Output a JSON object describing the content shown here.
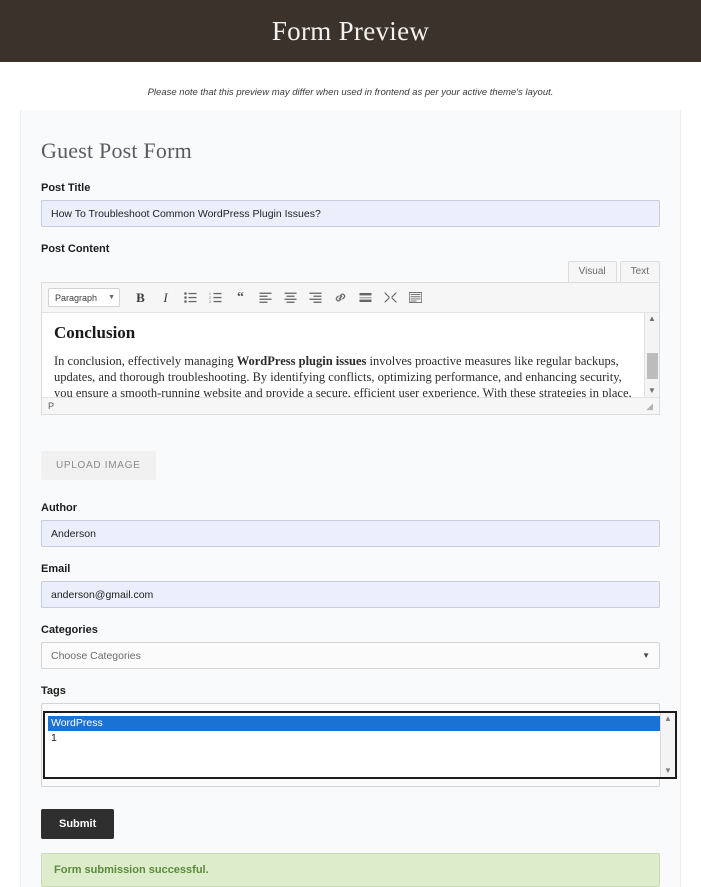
{
  "header": {
    "title": "Form Preview"
  },
  "notice": "Please note that this preview may differ when used in frontend as per your active theme's layout.",
  "form": {
    "title": "Guest Post Form",
    "post_title": {
      "label": "Post Title",
      "value": "How To Troubleshoot Common WordPress Plugin Issues?"
    },
    "post_content": {
      "label": "Post Content",
      "tabs": [
        {
          "label": "Visual",
          "active": true
        },
        {
          "label": "Text",
          "active": false
        }
      ],
      "toolbar": {
        "format_select": "Paragraph",
        "buttons": [
          "bold",
          "italic",
          "bulleted-list",
          "numbered-list",
          "blockquote",
          "align-left",
          "align-center",
          "align-right",
          "insert-link",
          "read-more",
          "distraction-free",
          "toolbar-toggle"
        ]
      },
      "heading": "Conclusion",
      "body_pre": "In conclusion, effectively managing ",
      "body_bold": "WordPress plugin issues",
      "body_post": " involves proactive measures like regular backups, updates, and thorough troubleshooting. By identifying conflicts, optimizing performance, and enhancing security, you ensure a smooth-running website and provide a secure, efficient user experience. With these strategies in place, you can mitigate risks",
      "status_path": "P"
    },
    "upload_button": "UPLOAD IMAGE",
    "author": {
      "label": "Author",
      "value": "Anderson"
    },
    "email": {
      "label": "Email",
      "value": "anderson@gmail.com"
    },
    "categories": {
      "label": "Categories",
      "placeholder": "Choose Categories"
    },
    "tags": {
      "label": "Tags",
      "options": [
        {
          "text": "WordPress",
          "selected": true
        },
        {
          "text": "1",
          "selected": false
        }
      ]
    },
    "submit_button": "Submit",
    "success_message": "Form submission successful."
  },
  "colors": {
    "header_bg": "#3b322c",
    "panel_bg": "#f9fafb",
    "input_bg": "#eaeffb",
    "selected_option": "#1a73d4",
    "submit_bg": "#2f2f2f",
    "success_bg": "#ddeccb",
    "success_text": "#5c8a3c"
  }
}
